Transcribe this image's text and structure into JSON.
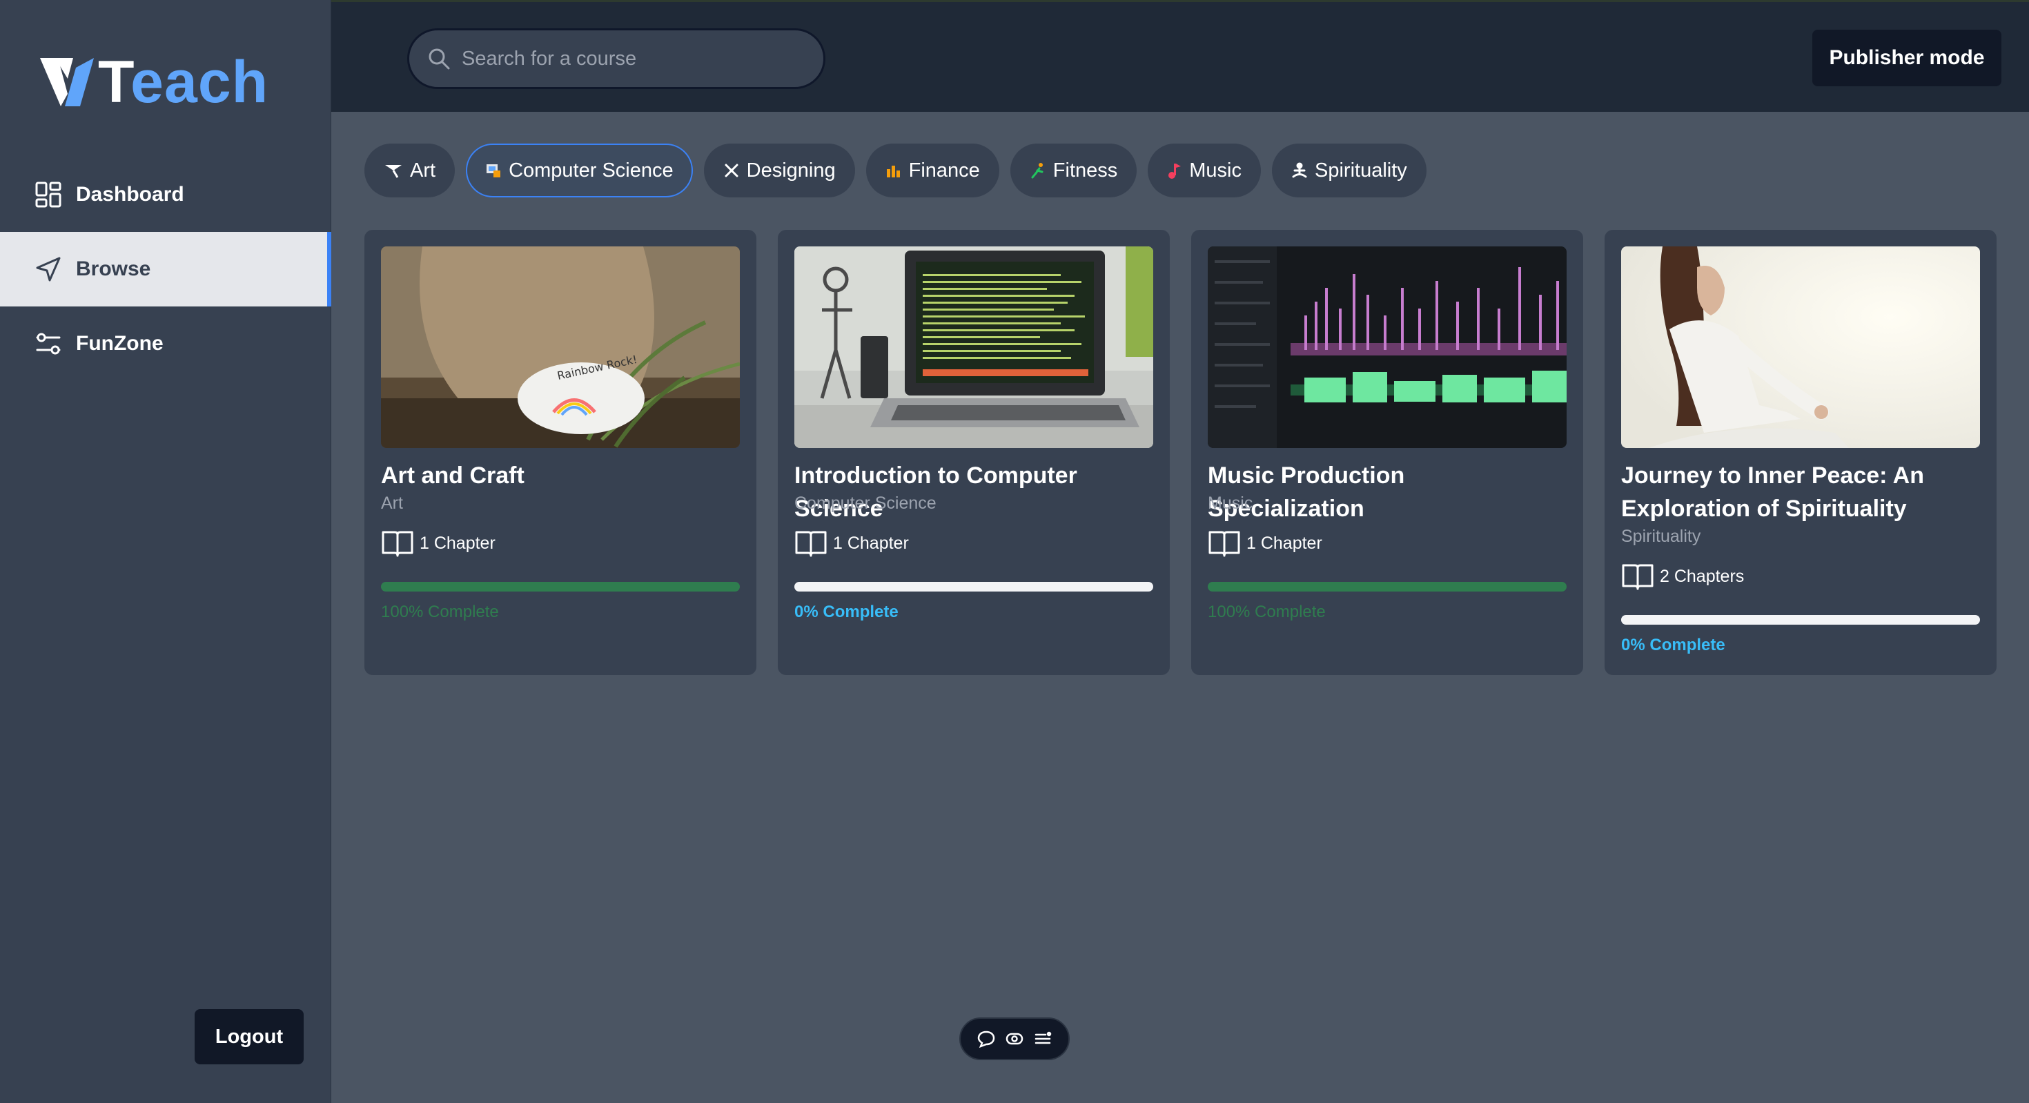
{
  "app": {
    "logo_letter": "T",
    "logo_rest": "each"
  },
  "sidebar": {
    "items": [
      {
        "label": "Dashboard",
        "icon": "dashboard-icon",
        "active": false
      },
      {
        "label": "Browse",
        "icon": "compass-icon",
        "active": true
      },
      {
        "label": "FunZone",
        "icon": "sliders-icon",
        "active": false
      }
    ],
    "logout_label": "Logout"
  },
  "header": {
    "search_placeholder": "Search for a course",
    "search_value": "",
    "publisher_label": "Publisher mode"
  },
  "categories": [
    {
      "label": "Art",
      "icon": "brush-icon",
      "selected": false
    },
    {
      "label": "Computer Science",
      "icon": "computer-icon",
      "selected": true
    },
    {
      "label": "Designing",
      "icon": "tools-icon",
      "selected": false
    },
    {
      "label": "Finance",
      "icon": "chart-icon",
      "selected": false
    },
    {
      "label": "Fitness",
      "icon": "runner-icon",
      "selected": false
    },
    {
      "label": "Music",
      "icon": "music-note-icon",
      "selected": false
    },
    {
      "label": "Spirituality",
      "icon": "meditation-icon",
      "selected": false
    }
  ],
  "courses": [
    {
      "title": "Art and Craft",
      "category": "Art",
      "chapters": "1 Chapter",
      "progress": 1.0,
      "progress_label": "100% Complete"
    },
    {
      "title": "Introduction to Computer Science",
      "category": "Computer Science",
      "chapters": "1 Chapter",
      "progress": 0.0,
      "progress_label": "0% Complete"
    },
    {
      "title": "Music Production Specialization",
      "category": "Music",
      "chapters": "1 Chapter",
      "progress": 1.0,
      "progress_label": "100% Complete"
    },
    {
      "title": "Journey to Inner Peace: An Exploration of Spirituality",
      "category": "Spirituality",
      "chapters": "2 Chapters",
      "progress": 0.0,
      "progress_label": "0% Complete"
    }
  ],
  "colors": {
    "accent": "#3b82f6",
    "complete": "#2f7d4f",
    "incomplete": "#38bdf8",
    "sidebar_bg": "#374151",
    "topbar_bg": "#1f2937",
    "page_bg": "#4b5563"
  },
  "toolbar": {
    "icons": [
      "comment-icon",
      "eye-icon",
      "menu-list-icon"
    ]
  }
}
